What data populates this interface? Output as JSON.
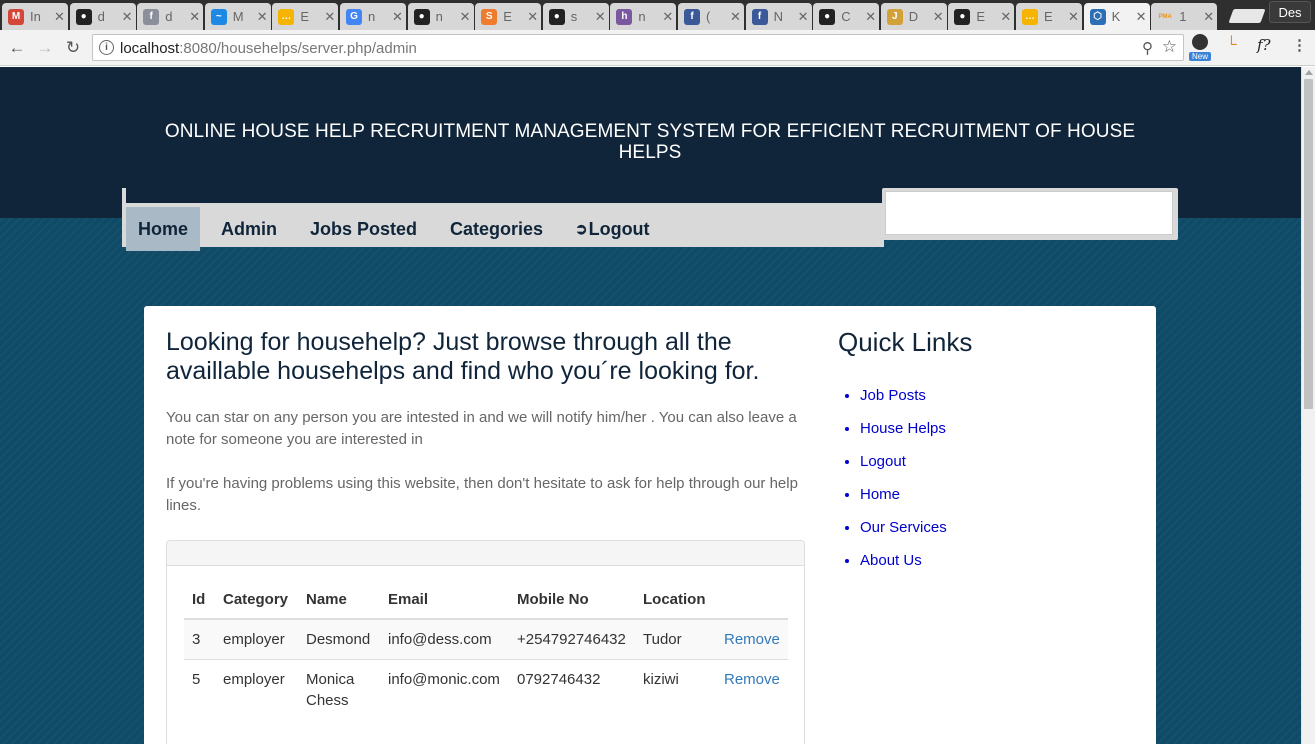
{
  "browser": {
    "tabs": [
      {
        "title": "In",
        "icon": "gmail-icon",
        "color": "#d44638",
        "glyph": "M"
      },
      {
        "title": "d",
        "icon": "github-icon",
        "color": "#222222",
        "glyph": "●"
      },
      {
        "title": "d",
        "icon": "facebook-icon",
        "color": "#8a8f99",
        "glyph": "f"
      },
      {
        "title": "M",
        "icon": "messenger-icon",
        "color": "#1e88e5",
        "glyph": "~"
      },
      {
        "title": "E",
        "icon": "slides-icon",
        "color": "#f4b400",
        "glyph": "…"
      },
      {
        "title": "n",
        "icon": "google-icon",
        "color": "#4285f4",
        "glyph": "G"
      },
      {
        "title": "n",
        "icon": "github-icon",
        "color": "#222222",
        "glyph": "●"
      },
      {
        "title": "E",
        "icon": "sublime-icon",
        "color": "#ef7b2c",
        "glyph": "S"
      },
      {
        "title": "s",
        "icon": "github-icon",
        "color": "#222222",
        "glyph": "●"
      },
      {
        "title": "n",
        "icon": "heroku-icon",
        "color": "#79589f",
        "glyph": "h"
      },
      {
        "title": "(",
        "icon": "facebook-icon",
        "color": "#3b5998",
        "glyph": "f"
      },
      {
        "title": "N",
        "icon": "facebook-icon",
        "color": "#3b5998",
        "glyph": "f"
      },
      {
        "title": "C",
        "icon": "github-icon",
        "color": "#222222",
        "glyph": "●"
      },
      {
        "title": "D",
        "icon": "jenkins-icon",
        "color": "#d3a13a",
        "glyph": "J"
      },
      {
        "title": "E",
        "icon": "github-icon",
        "color": "#222222",
        "glyph": "●"
      },
      {
        "title": "E",
        "icon": "slides-icon",
        "color": "#f4b400",
        "glyph": "…"
      },
      {
        "title": "K",
        "icon": "app-icon",
        "color": "#2c6fb5",
        "glyph": "⬡",
        "active": true
      },
      {
        "title": "1",
        "icon": "phpmyadmin-icon",
        "color": "#f29111",
        "glyph": "PMA"
      }
    ],
    "profile_label": "Des",
    "url_host": "localhost",
    "url_rest": ":8080/househelps/server.php/admin"
  },
  "site": {
    "title": "ONLINE HOUSE HELP RECRUITMENT MANAGEMENT SYSTEM FOR EFFICIENT RECRUITMENT OF HOUSE HELPS",
    "nav": [
      {
        "label": "Home",
        "active": true
      },
      {
        "label": "Admin"
      },
      {
        "label": "Jobs Posted"
      },
      {
        "label": "Categories"
      },
      {
        "label": "Logout",
        "icon": "logout-icon"
      }
    ],
    "search_value": ""
  },
  "main": {
    "lead": "Looking for househelp? Just browse through all the availlable househelps and find who you´re looking for.",
    "para1": "You can star on any person you are intested in and we will notify him/her . You can also leave a note for someone you are interested in",
    "para2": "If you're having problems using this website, then don't hesitate to ask for help through our help lines.",
    "table": {
      "headers": [
        "Id",
        "Category",
        "Name",
        "Email",
        "Mobile No",
        "Location",
        ""
      ],
      "rows": [
        {
          "id": "3",
          "category": "employer",
          "name": "Desmond",
          "email": "info@dess.com",
          "mobile": "+254792746432",
          "location": "Tudor",
          "action": "Remove"
        },
        {
          "id": "5",
          "category": "employer",
          "name": "Monica Chess",
          "email": "info@monic.com",
          "mobile": "0792746432",
          "location": "kiziwi",
          "action": "Remove"
        }
      ]
    }
  },
  "quick_links": {
    "title": "Quick Links",
    "items": [
      "Job Posts",
      "House Helps",
      "Logout",
      "Home",
      "Our Services",
      "About Us"
    ]
  }
}
